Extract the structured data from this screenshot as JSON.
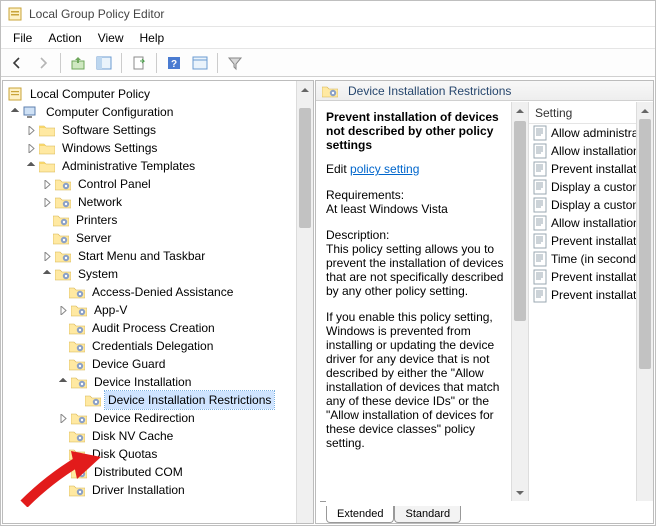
{
  "window": {
    "title": "Local Group Policy Editor"
  },
  "menu": {
    "file": "File",
    "action": "Action",
    "view": "View",
    "help": "Help"
  },
  "tree": {
    "root": "Local Computer Policy",
    "computer_config": "Computer Configuration",
    "software_settings": "Software Settings",
    "windows_settings": "Windows Settings",
    "admin_templates": "Administrative Templates",
    "control_panel": "Control Panel",
    "network": "Network",
    "printers": "Printers",
    "server": "Server",
    "start_menu": "Start Menu and Taskbar",
    "system": "System",
    "access_denied": "Access-Denied Assistance",
    "appv": "App-V",
    "audit_process": "Audit Process Creation",
    "credentials": "Credentials Delegation",
    "device_guard": "Device Guard",
    "device_install": "Device Installation",
    "device_install_restrictions": "Device Installation Restrictions",
    "device_redirect": "Device Redirection",
    "disk_nv": "Disk NV Cache",
    "disk_quotas": "Disk Quotas",
    "dist_com": "Distributed COM",
    "driver_install": "Driver Installation"
  },
  "detail": {
    "breadcrumb": "Device Installation Restrictions",
    "selected_title": "Prevent installation of devices not described by other policy settings",
    "edit_label": "Edit",
    "edit_link": "policy setting",
    "req_label": "Requirements:",
    "req_value": "At least Windows Vista",
    "desc_label": "Description:",
    "desc_p1": "This policy setting allows you to prevent the installation of devices that are not specifically described by any other policy setting.",
    "desc_p2": "If you enable this policy setting, Windows is prevented from installing or updating the device driver for any device that is not described by either the \"Allow installation of devices that match any of these device IDs\" or the \"Allow installation of devices for these device classes\" policy setting."
  },
  "list": {
    "header": "Setting",
    "items": [
      "Allow administrators",
      "Allow installation of",
      "Prevent installation o",
      "Display a custom m",
      "Display a custom m",
      "Allow installation of",
      "Prevent installation o",
      "Time (in seconds) to",
      "Prevent installation o",
      "Prevent installation o"
    ]
  },
  "tabs": {
    "extended": "Extended",
    "standard": "Standard"
  }
}
